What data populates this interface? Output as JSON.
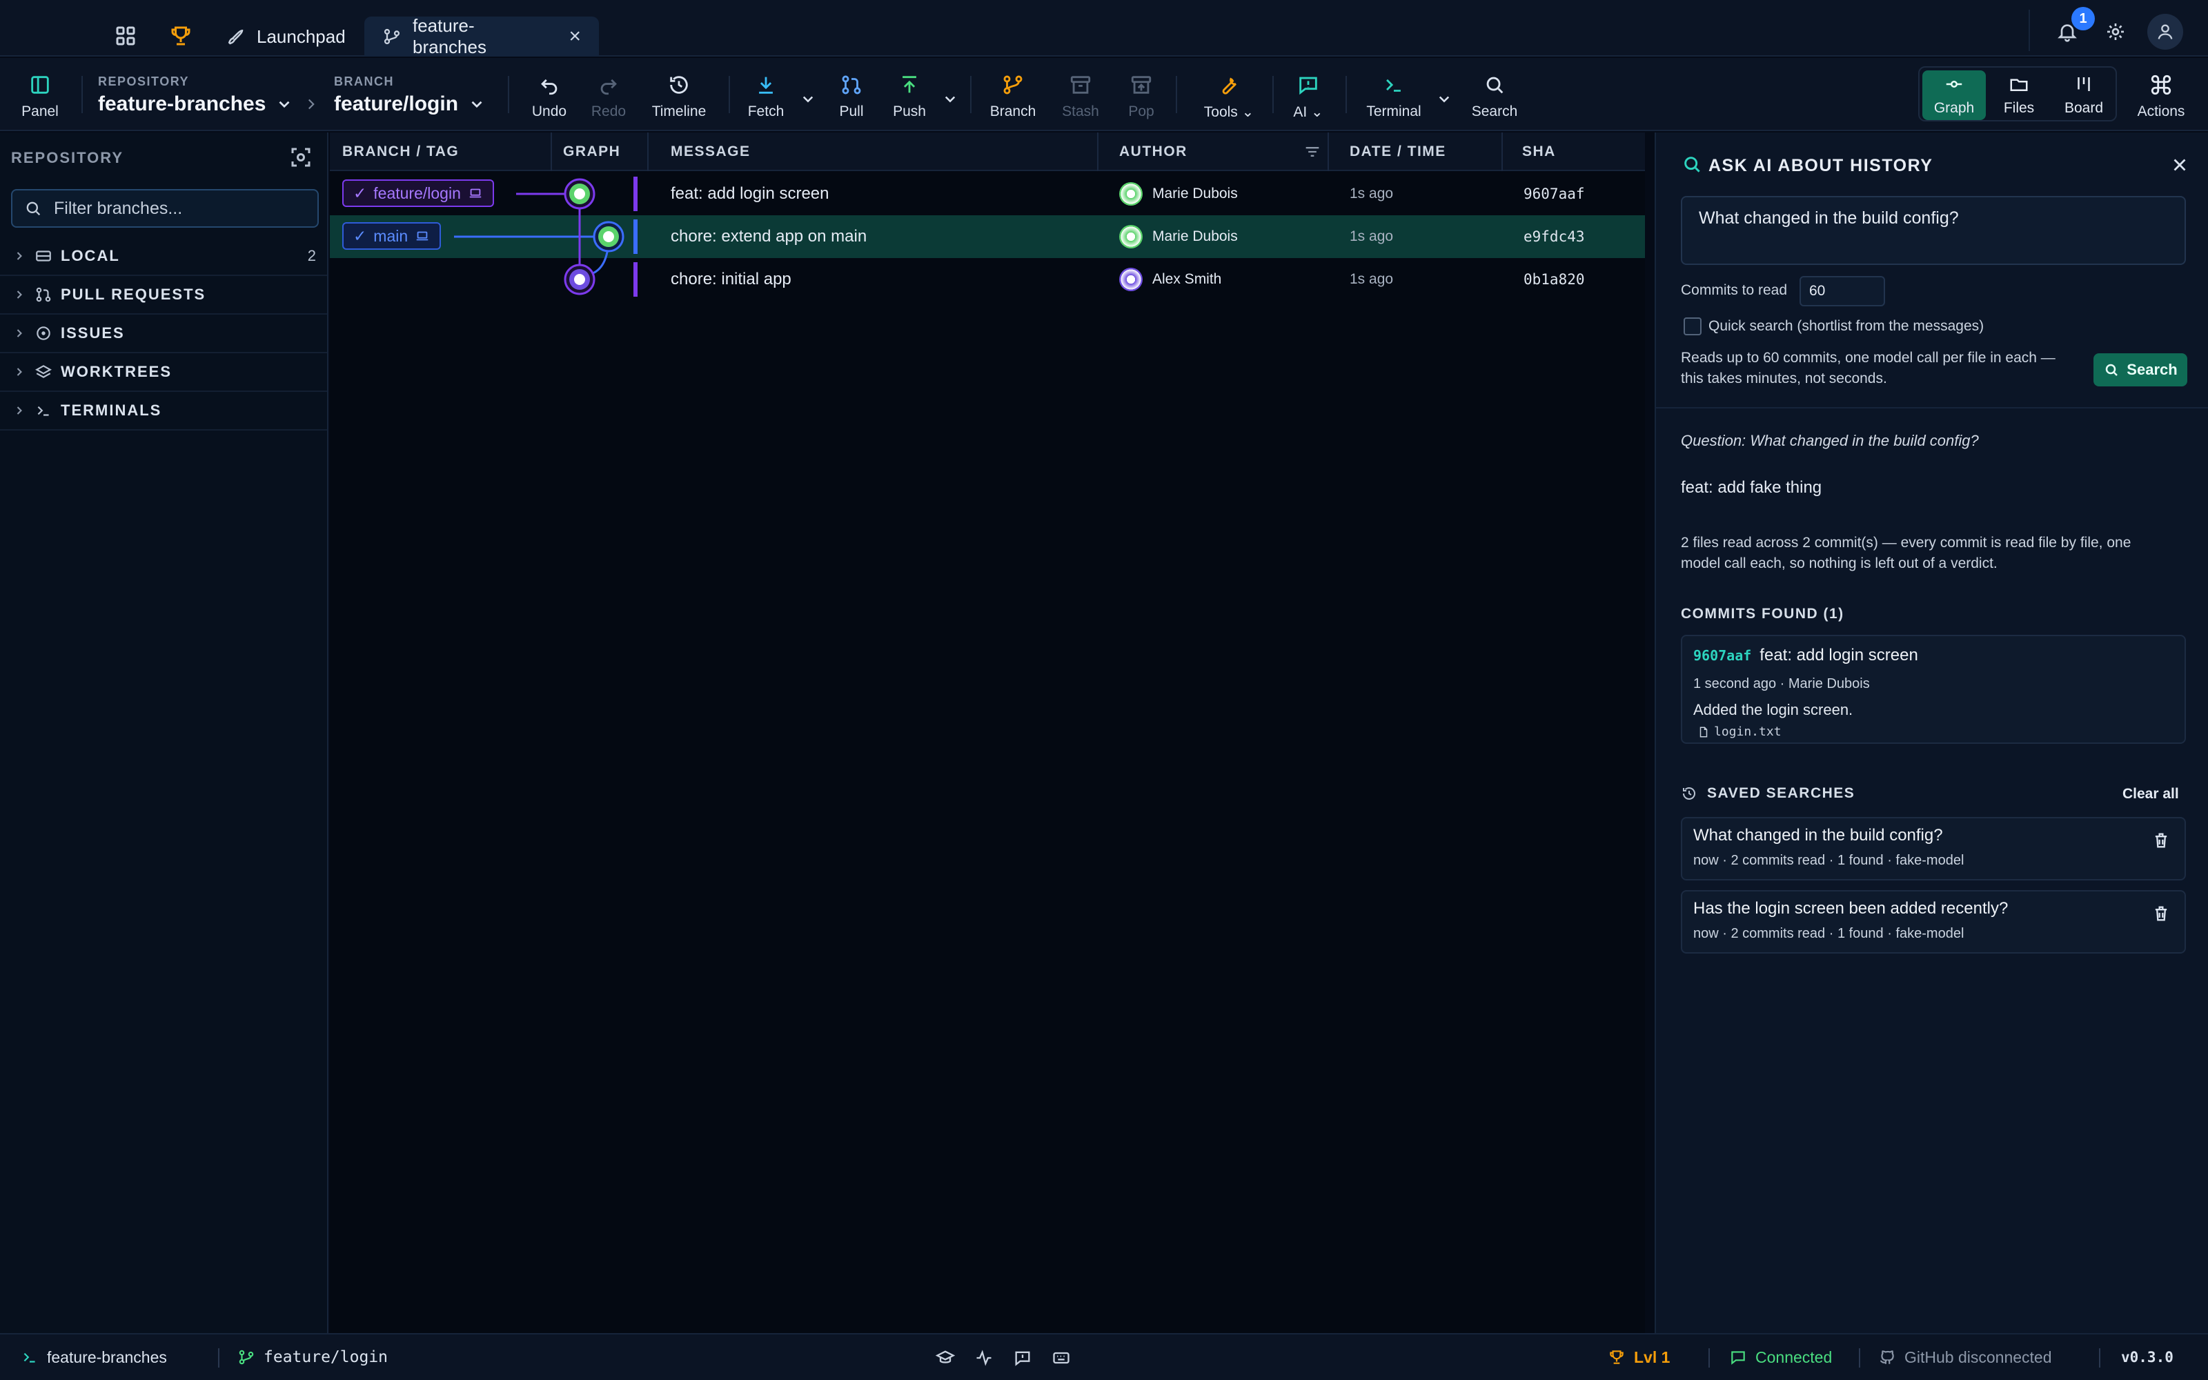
{
  "tabs": [
    {
      "label": "Launchpad",
      "icon": "rocket-icon"
    },
    {
      "label": "feature-branches",
      "icon": "git-branch-icon"
    }
  ],
  "notifications_count": "1",
  "toolbar": {
    "panel_label": "Panel",
    "repository_label": "REPOSITORY",
    "repository_value": "feature-branches",
    "branch_label": "BRANCH",
    "branch_value": "feature/login",
    "undo": "Undo",
    "redo": "Redo",
    "timeline": "Timeline",
    "fetch": "Fetch",
    "pull": "Pull",
    "push": "Push",
    "branch": "Branch",
    "stash": "Stash",
    "pop": "Pop",
    "tools": "Tools",
    "ai": "AI",
    "terminal": "Terminal",
    "search": "Search",
    "views": [
      "Graph",
      "Files",
      "Board"
    ],
    "actions": "Actions"
  },
  "left_panel": {
    "title": "REPOSITORY",
    "filter_placeholder": "Filter branches...",
    "sections": [
      {
        "label": "LOCAL",
        "count": "2",
        "icon": "drive-icon"
      },
      {
        "label": "PULL REQUESTS",
        "count": "",
        "icon": "pull-request-icon"
      },
      {
        "label": "ISSUES",
        "count": "",
        "icon": "issue-icon"
      },
      {
        "label": "WORKTREES",
        "count": "",
        "icon": "layers-icon"
      },
      {
        "label": "TERMINALS",
        "count": "",
        "icon": "terminal-icon"
      }
    ]
  },
  "graph": {
    "columns": [
      "BRANCH / TAG",
      "GRAPH",
      "MESSAGE",
      "AUTHOR",
      "DATE / TIME",
      "SHA"
    ],
    "rows": [
      {
        "branch": "feature/login",
        "message": "feat: add login screen",
        "author": "Marie Dubois",
        "time": "1s ago",
        "sha": "9607aaf",
        "selected": false
      },
      {
        "branch": "main",
        "message": "chore: extend app on main",
        "author": "Marie Dubois",
        "time": "1s ago",
        "sha": "e9fdc43",
        "selected": true
      },
      {
        "branch": "",
        "message": "chore: initial app",
        "author": "Alex Smith",
        "time": "1s ago",
        "sha": "0b1a820",
        "selected": false
      }
    ],
    "colors": {
      "feature": "#9b4dff",
      "main": "#3b6dff",
      "selected_row": "#0b3a36"
    }
  },
  "ai_panel": {
    "title": "ASK AI ABOUT HISTORY",
    "question_input": "What changed in the build config?",
    "commits_to_read_label": "Commits to read",
    "commits_to_read_value": "60",
    "quick_search_label": "Quick search (shortlist from the messages)",
    "note_line1": "Reads up to 60 commits, one model call per file in each —",
    "note_line2": "this takes minutes, not seconds.",
    "search_button": "Search",
    "question_label": "Question: What changed in the build config?",
    "answer": "feat: add fake thing",
    "summary_line1": "2 files read across 2 commit(s) — every commit is read file by file, one",
    "summary_line2": "model call each, so nothing is left out of a verdict.",
    "commits_found_title": "COMMITS FOUND (1)",
    "found_commit": {
      "sha": "9607aaf",
      "message": "feat: add login screen",
      "meta": "1 second ago · Marie Dubois",
      "description": "Added the login screen.",
      "file": "login.txt"
    },
    "saved_title": "SAVED SEARCHES",
    "clear_all": "Clear all",
    "saved": [
      {
        "question": "What changed in the build config?",
        "meta": "now · 2 commits read · 1 found · fake-model"
      },
      {
        "question": "Has the login screen been added recently?",
        "meta": "now · 2 commits read · 1 found · fake-model"
      }
    ]
  },
  "status_bar": {
    "repo": "feature-branches",
    "branch": "feature/login",
    "level": "Lvl 1",
    "connection": "Connected",
    "github": "GitHub disconnected",
    "version": "v0.3.0"
  }
}
